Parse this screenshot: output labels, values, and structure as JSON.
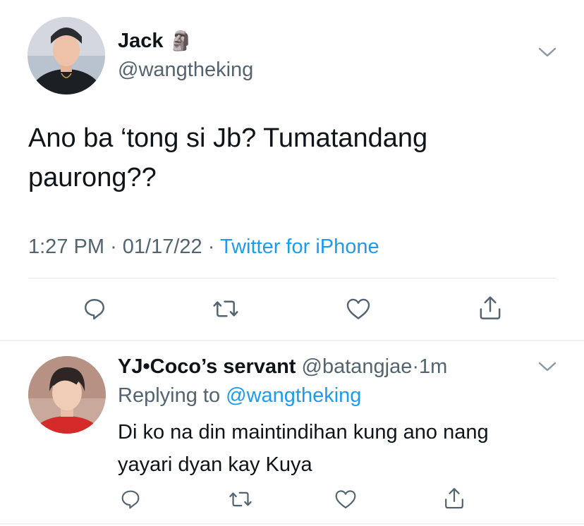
{
  "main_tweet": {
    "display_name": "Jack",
    "name_emoji": "🗿",
    "handle": "@wangtheking",
    "text_line1": "Ano ba ‘tong si Jb? Tumatandang",
    "text_line2": "paurong??",
    "time": "1:27 PM",
    "date": "01/17/22",
    "dot": "·",
    "source": "Twitter for iPhone"
  },
  "reply": {
    "display_name": "YJ•Coco’s servant",
    "handle": "@batangjae",
    "dot": "·",
    "time": "1m",
    "replying_prefix": "Replying to",
    "replying_handle": "@wangtheking",
    "text_line1": "Di ko na din maintindihan kung ano nang",
    "text_line2": "yayari dyan kay Kuya"
  },
  "icons": {
    "reply": "comment-icon",
    "retweet": "retweet-icon",
    "like": "heart-icon",
    "share": "share-icon",
    "menu": "chevron-down-icon"
  },
  "colors": {
    "link": "#1d9bf0",
    "secondary_text": "#536471",
    "primary_text": "#0f1419"
  }
}
